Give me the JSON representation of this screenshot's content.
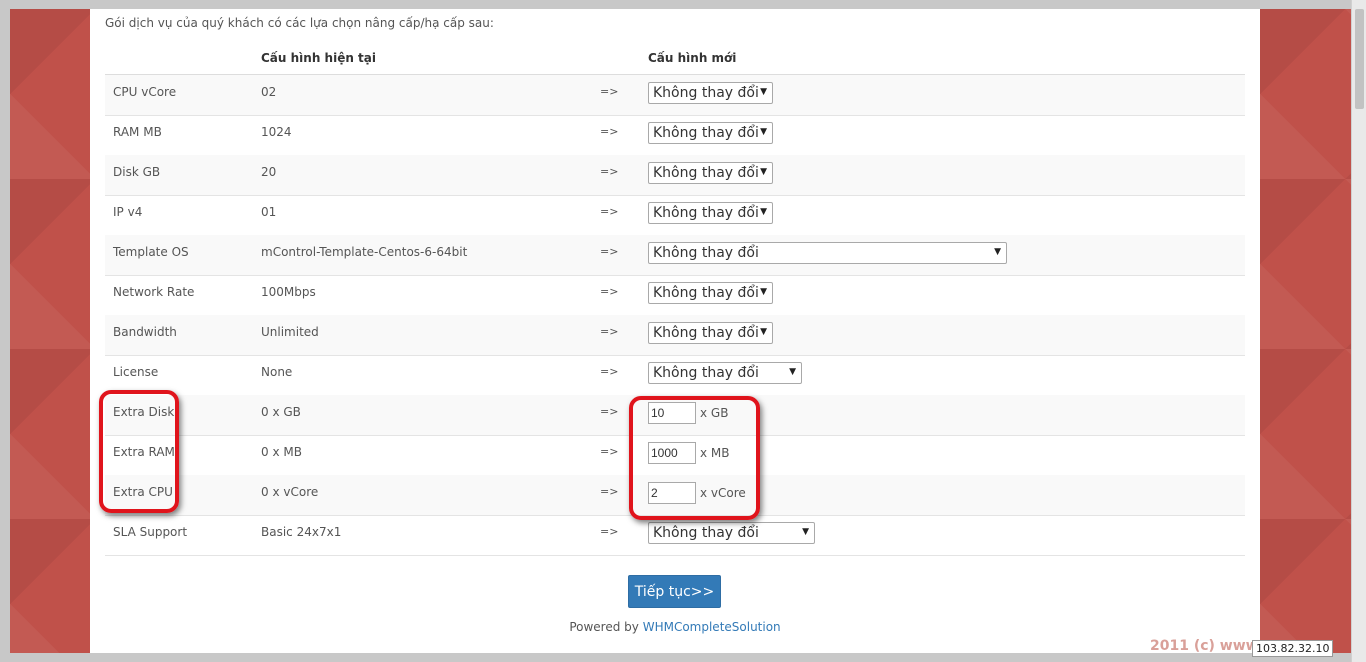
{
  "intro": "Gói dịch vụ của quý khách có các lựa chọn nâng cấp/hạ cấp sau:",
  "headers": {
    "current": "Cấu hình hiện tại",
    "new": "Cấu hình mới"
  },
  "arrow": "=>",
  "rows": [
    {
      "label": "CPU vCore",
      "current": "02",
      "kind": "select",
      "value": "Không thay đổi"
    },
    {
      "label": "RAM MB",
      "current": "1024",
      "kind": "select",
      "value": "Không thay đổi"
    },
    {
      "label": "Disk GB",
      "current": "20",
      "kind": "select",
      "value": "Không thay đổi"
    },
    {
      "label": "IP v4",
      "current": "01",
      "kind": "select",
      "value": "Không thay đổi"
    },
    {
      "label": "Template OS",
      "current": "mControl-Template-Centos-6-64bit",
      "kind": "select",
      "value": "Không thay đổi"
    },
    {
      "label": "Network Rate",
      "current": "100Mbps",
      "kind": "select",
      "value": "Không thay đổi"
    },
    {
      "label": "Bandwidth",
      "current": "Unlimited",
      "kind": "select",
      "value": "Không thay đổi"
    },
    {
      "label": "License",
      "current": "None",
      "kind": "select",
      "value": "Không thay đổi"
    },
    {
      "label": "Extra Disk",
      "current": "0 x GB",
      "kind": "input",
      "value": "10",
      "unit": "x GB"
    },
    {
      "label": "Extra RAM",
      "current": "0 x MB",
      "kind": "input",
      "value": "1000",
      "unit": "x MB"
    },
    {
      "label": "Extra CPU",
      "current": "0 x vCore",
      "kind": "input",
      "value": "2",
      "unit": "x vCore"
    },
    {
      "label": "SLA Support",
      "current": "Basic 24x7x1",
      "kind": "select",
      "value": "Không thay đổi"
    }
  ],
  "button": "Tiếp tục>>",
  "powered": {
    "prefix": "Powered by ",
    "link": "WHMCompleteSolution"
  },
  "footer": {
    "watermark": "2011 (c) www.",
    "ip": "103.82.32.10"
  },
  "colors": {
    "accent": "#337ab7",
    "background_panel": "#c0514a",
    "highlight": "#e0141c"
  }
}
